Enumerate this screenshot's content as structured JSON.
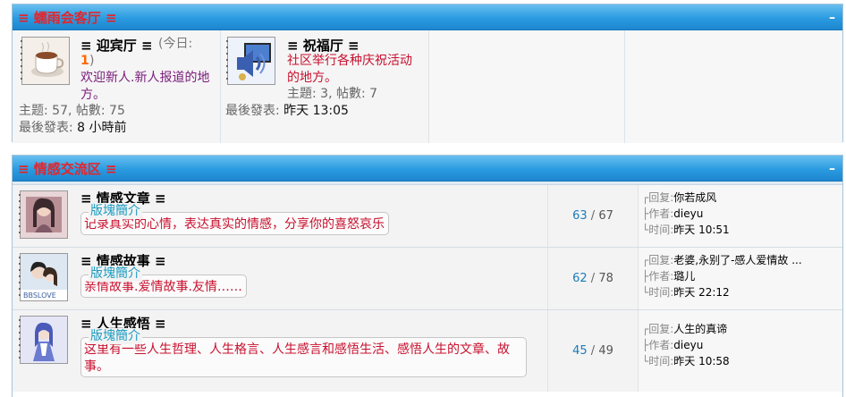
{
  "sections": [
    {
      "title": "≡ 蠕雨会客厅 ≡",
      "collapse": "–",
      "cells": [
        {
          "name": "≡ 迎宾厅 ≡",
          "today_prefix": "(今日:",
          "today_num": "1",
          "today_suffix": ")",
          "desc": "欢迎新人.新人报道的地方。",
          "stats": "主题: 57, 帖數: 75",
          "last_label": "最後發表:",
          "last_value": "8 小時前",
          "icon": "coffee-cup-icon"
        },
        {
          "name": "≡ 祝福厅 ≡",
          "desc": "社区举行各种庆祝活动的地方。",
          "stats": "主題: 3, 帖數: 7",
          "last_label": "最後發表:",
          "last_value": "昨天 13:05",
          "icon": "media-speaker-icon"
        }
      ]
    },
    {
      "title": "≡ 情感交流区 ≡",
      "collapse": "–",
      "rows": [
        {
          "name": "≡ 情感文章 ≡",
          "legend": "版塊簡介",
          "desc": "记录真实的心情，表达真实的情感，分享你的喜怒哀乐",
          "threads": "63",
          "posts": "67",
          "reply_label": "┌回复:",
          "reply_value": "你若成风",
          "author_label": "├作者:",
          "author_value": "dieyu",
          "time_label": "└时间:",
          "time_value": "昨天 10:51",
          "icon": "girl-portrait-icon"
        },
        {
          "name": "≡ 情感故事 ≡",
          "legend": "版塊簡介",
          "desc": "亲情故事.爱情故事.友情……",
          "threads": "62",
          "posts": "78",
          "reply_label": "┌回复:",
          "reply_value": "老婆,永别了-感人爱情故 ...",
          "author_label": "├作者:",
          "author_value": "璐儿",
          "time_label": "└时间:",
          "time_value": "昨天 22:12",
          "icon": "couple-portrait-icon",
          "icon_caption": "BBSLOVE"
        },
        {
          "name": "≡ 人生感悟 ≡",
          "legend": "版塊簡介",
          "desc": "这里有一些人生哲理、人生格言、人生感言和感悟生活、感悟人生的文章、故事。",
          "threads": "45",
          "posts": "49",
          "reply_label": "┌回复:",
          "reply_value": "人生的真谛",
          "author_label": "├作者:",
          "author_value": "dieyu",
          "time_label": "└时间:",
          "time_value": "昨天 10:58",
          "icon": "anime-girl-icon"
        }
      ]
    }
  ],
  "num_separator": " / "
}
